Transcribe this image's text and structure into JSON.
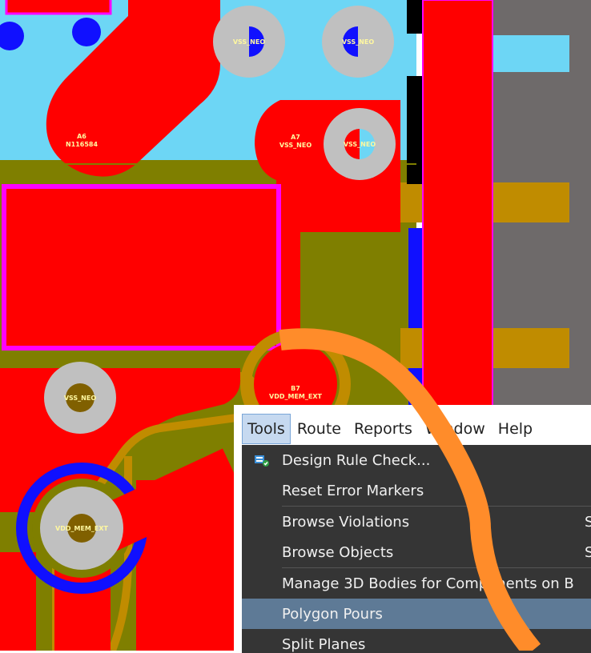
{
  "pcb": {
    "pads": {
      "a6_name": "A6",
      "a6_net": "N116584",
      "a7_name": "A7",
      "a7_net": "VSS_NEO",
      "b7_name": "B7",
      "b7_net": "VDD_MEM_EXT"
    },
    "vias": {
      "v1": "VSS_NEO",
      "v2": "VSS_NEO",
      "v3": "VSS_NEO",
      "v4": "VSS_NEO",
      "v5": "VDD_MEM_EXT"
    },
    "colors": {
      "copper_top": "#ff0000",
      "plane": "#6dd6f5",
      "ground": "#7f7f00",
      "trace_gold": "#c08c00",
      "via_ring": "#c0c0c0",
      "keepout": "#ff00ff",
      "board_gray": "#6e6a6a",
      "highlight_arc": "#ff8c2a"
    }
  },
  "menubar": {
    "tools": "Tools",
    "route": "Route",
    "reports": "Reports",
    "window": "Window",
    "help": "Help"
  },
  "tools_menu": {
    "items": [
      {
        "label": "Design Rule Check...",
        "icon": "design-rule-check-icon",
        "shortcut": ""
      },
      {
        "label": "Reset Error Markers",
        "icon": "",
        "shortcut": ""
      },
      {
        "label": "Browse Violations",
        "icon": "",
        "shortcut": "S"
      },
      {
        "label": "Browse Objects",
        "icon": "",
        "shortcut": "S"
      },
      {
        "label": "Manage 3D Bodies for Components on B",
        "icon": "",
        "shortcut": ""
      },
      {
        "label": "Polygon Pours",
        "icon": "",
        "shortcut": ""
      },
      {
        "label": "Split Planes",
        "icon": "",
        "shortcut": ""
      }
    ],
    "highlighted_index": 5
  }
}
